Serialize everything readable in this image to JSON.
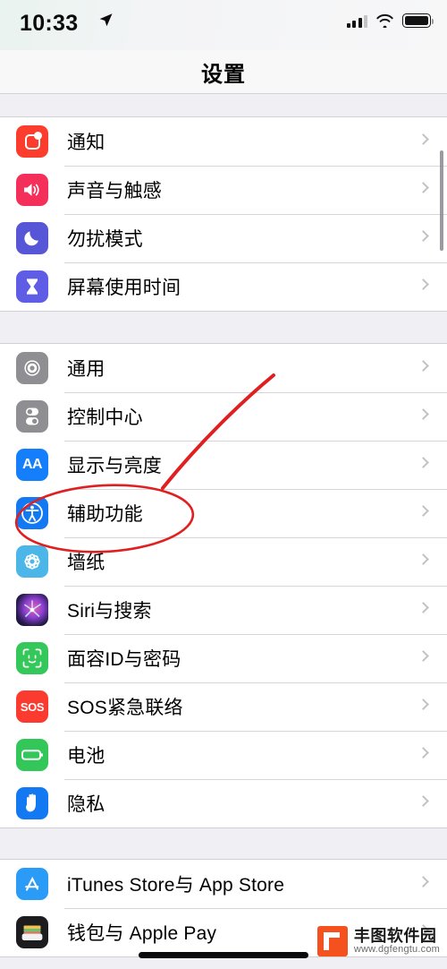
{
  "status_bar": {
    "time": "10:33",
    "location_icon": "location-arrow-icon",
    "signal_icon": "cellular-signal-icon",
    "wifi_icon": "wifi-icon",
    "battery_icon": "battery-full-icon"
  },
  "nav": {
    "title": "设置"
  },
  "groups": [
    {
      "rows": [
        {
          "label": "通知",
          "icon": "notifications-icon",
          "color": "#FC3C2D"
        },
        {
          "label": "声音与触感",
          "icon": "sounds-haptics-icon",
          "color": "#F4305A"
        },
        {
          "label": "勿扰模式",
          "icon": "do-not-disturb-icon",
          "color": "#5756D6"
        },
        {
          "label": "屏幕使用时间",
          "icon": "screen-time-icon",
          "color": "#5F5CE6"
        }
      ]
    },
    {
      "rows": [
        {
          "label": "通用",
          "icon": "general-gear-icon",
          "color": "#8E8E93"
        },
        {
          "label": "控制中心",
          "icon": "control-center-icon",
          "color": "#8E8E93"
        },
        {
          "label": "显示与亮度",
          "icon": "display-brightness-icon",
          "color": "#147EFB"
        },
        {
          "label": "辅助功能",
          "icon": "accessibility-icon",
          "color": "#1379F2"
        },
        {
          "label": "墙纸",
          "icon": "wallpaper-icon",
          "color": "#4CB6E8"
        },
        {
          "label": "Siri与搜索",
          "icon": "siri-icon",
          "color": "#241A4A"
        },
        {
          "label": "面容ID与密码",
          "icon": "face-id-icon",
          "color": "#34C85A"
        },
        {
          "label": "SOS紧急联络",
          "icon": "emergency-sos-icon",
          "color": "#FC3B30"
        },
        {
          "label": "电池",
          "icon": "battery-icon",
          "color": "#33C759"
        },
        {
          "label": "隐私",
          "icon": "privacy-hand-icon",
          "color": "#1379F2"
        }
      ]
    },
    {
      "rows": [
        {
          "label": "iTunes Store与 App Store",
          "icon": "app-store-icon",
          "color": "#2A9BF6"
        },
        {
          "label": "钱包与 Apple Pay",
          "icon": "wallet-icon",
          "color": "#1C1C1E"
        }
      ]
    }
  ],
  "annotations": {
    "highlight_color": "#E02020",
    "ellipse_target": "辅助功能",
    "arrow_target": "辅助功能"
  },
  "watermark": {
    "name": "丰图软件园",
    "url": "www.dgfengtu.com"
  }
}
